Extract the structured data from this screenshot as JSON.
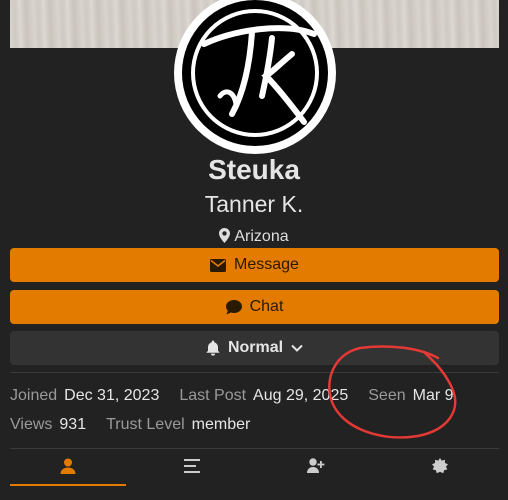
{
  "profile": {
    "username": "Steuka",
    "full_name": "Tanner K.",
    "location": "Arizona",
    "avatar_initials": "tK"
  },
  "actions": {
    "message_label": "Message",
    "chat_label": "Chat",
    "notification_level": "Normal"
  },
  "stats": {
    "joined_label": "Joined",
    "joined_value": "Dec 31, 2023",
    "last_post_label": "Last Post",
    "last_post_value": "Aug 29, 2025",
    "seen_label": "Seen",
    "seen_value": "Mar 9",
    "views_label": "Views",
    "views_value": "931",
    "trust_label": "Trust Level",
    "trust_value": "member"
  },
  "tabs": [
    {
      "icon": "user-icon",
      "active": true
    },
    {
      "icon": "activity-list-icon",
      "active": false
    },
    {
      "icon": "user-plus-icon",
      "active": false
    },
    {
      "icon": "badge-icon",
      "active": false
    }
  ],
  "colors": {
    "accent": "#e27b00",
    "background": "#222222",
    "annotation": "#e53935"
  }
}
